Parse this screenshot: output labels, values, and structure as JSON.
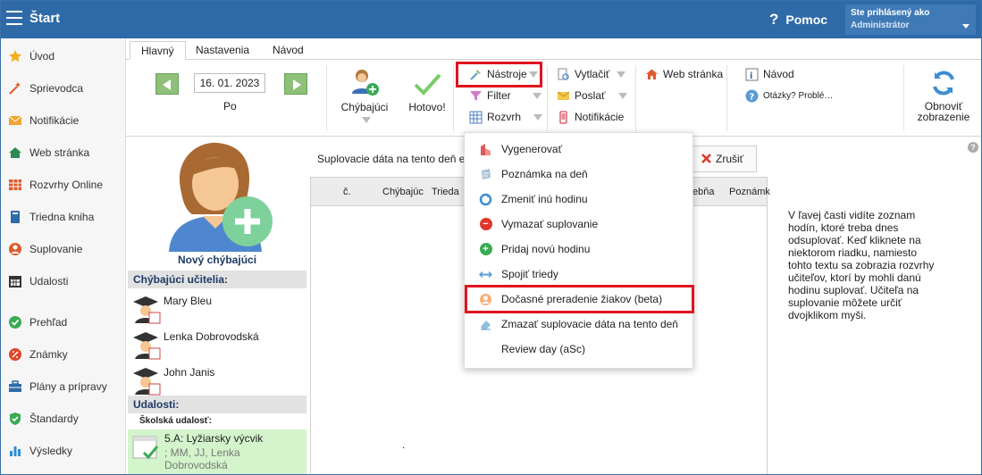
{
  "app": {
    "title": "Štart",
    "help_label": "Pomoc",
    "help_glyph": "?",
    "user_label": "Ste prihlásený ako",
    "user_role": "Administrátor"
  },
  "sidebar": {
    "items": [
      {
        "label": "Úvod",
        "icon": "star-icon",
        "color": "#f2b01e"
      },
      {
        "label": "Sprievodca",
        "icon": "wand-icon",
        "color": "#e05a2b"
      },
      {
        "label": "Notifikácie",
        "icon": "envelope-icon",
        "color": "#f2a431"
      },
      {
        "label": "Web stránka",
        "icon": "house-icon",
        "color": "#2e8b57"
      },
      {
        "label": "Rozvrhy Online",
        "icon": "timetable-icon",
        "color": "#e05a2b"
      },
      {
        "label": "Triedna kniha",
        "icon": "book-icon",
        "color": "#2e6aa7"
      },
      {
        "label": "Suplovanie",
        "icon": "person-icon",
        "color": "#e05a2b"
      },
      {
        "label": "Udalosti",
        "icon": "calendar-icon",
        "color": "#333333"
      },
      {
        "label": "Prehľad",
        "icon": "check-circle-icon",
        "color": "#3aaa55"
      },
      {
        "label": "Známky",
        "icon": "grades-icon",
        "color": "#e0462b"
      },
      {
        "label": "Plány a prípravy",
        "icon": "briefcase-icon",
        "color": "#2e6aa7"
      },
      {
        "label": "Štandardy",
        "icon": "shield-icon",
        "color": "#3aaa55"
      },
      {
        "label": "Výsledky",
        "icon": "bar-chart-icon",
        "color": "#2e8fd6"
      }
    ]
  },
  "tabs": [
    {
      "label": "Hlavný"
    },
    {
      "label": "Nastavenia"
    },
    {
      "label": "Návod"
    }
  ],
  "ribbon": {
    "date": "16. 01. 2023",
    "day": "Po",
    "absent_label": "Chýbajúci",
    "done_label": "Hotovo!",
    "tools_label": "Nástroje",
    "filter_label": "Filter",
    "schedule_label": "Rozvrh",
    "print_label": "Vytlačiť",
    "send_label": "Poslať",
    "notif_label": "Notifikácie",
    "web_label": "Web stránka",
    "guide_label": "Návod",
    "faq_label": "Otázky? Problé…",
    "refresh_label_1": "Obnoviť",
    "refresh_label_2": "zobrazenie"
  },
  "left_panel": {
    "new_absent_label": "Nový chýbajúci",
    "absent_teachers_header": "Chýbajúci učitelia:",
    "teachers": [
      "Mary Bleu",
      "Lenka Dobrovodská",
      "John Janis"
    ],
    "events_header": "Udalosti:",
    "school_event_label": "Školská udalosť:",
    "event_title": "5.A: Lyžiarsky výcvik",
    "event_detail_1": "; MM, JJ, Lenka",
    "event_detail_2": "Dobrovodská"
  },
  "main": {
    "data_header": "Suplovacie dáta na tento deň e",
    "cancel_label": "Zrušiť",
    "grid_columns": [
      "č.",
      "Chýbajúc",
      "Trieda",
      "ebňa",
      "Poznámk"
    ],
    "dot": ".",
    "info_text": "V ľavej časti vidíte zoznam hodín, ktoré treba dnes odsuplovať. Keď kliknete na niektorom riadku, namiesto tohto textu sa zobrazia rozvrhy učiteľov, ktorí by mohli danú hodinu suplovať. Učiteľa na suplovanie môžete určiť dvojklikom myši.",
    "help_glyph": "?"
  },
  "menu": {
    "items": [
      {
        "label": "Vygenerovať",
        "icon": "generate-icon"
      },
      {
        "label": "Poznámka na deň",
        "icon": "note-icon"
      },
      {
        "label": "Zmeniť inú hodinu",
        "icon": "refresh-icon"
      },
      {
        "label": "Vymazať suplovanie",
        "icon": "minus-circle-icon"
      },
      {
        "label": "Pridaj novú hodinu",
        "icon": "plus-circle-icon"
      },
      {
        "label": "Spojiť triedy",
        "icon": "join-arrows-icon"
      },
      {
        "label": "Dočasné preradenie žiakov (beta)",
        "icon": "student-transfer-icon"
      },
      {
        "label": "Zmazať suplovacie dáta na tento deň",
        "icon": "erase-icon"
      },
      {
        "label": "Review day (aSc)",
        "icon": ""
      }
    ]
  },
  "colors": {
    "topbar": "#2e6aa7",
    "highlight": "#e0141e",
    "event_bg": "#d4f5cc"
  }
}
